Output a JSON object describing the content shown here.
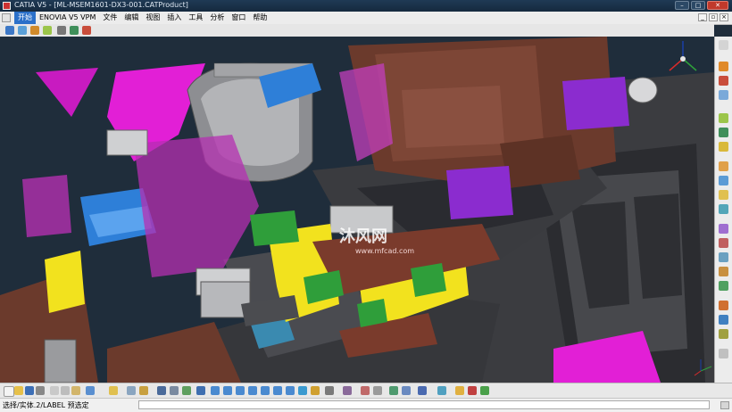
{
  "window": {
    "title": "CATIA V5 - [ML-MSEM1601-DX3-001.CATProduct]"
  },
  "menubar": {
    "items": [
      "开始",
      "ENOVIA V5 VPM",
      "文件",
      "编辑",
      "视图",
      "插入",
      "工具",
      "分析",
      "窗口",
      "帮助"
    ]
  },
  "watermark": {
    "text": "沐风网",
    "sub": "www.mfcad.com"
  },
  "status": {
    "text": "选择/实体.2/LABEL 预选定"
  },
  "branding": {
    "logo_text": "CATIA"
  },
  "colors": {
    "viewport_bg": "#1f2d3b",
    "menu_active": "#2b70c9",
    "part_magenta": "#e21fd6",
    "part_brown": "#6b3a2c",
    "part_yellow": "#f2e21e",
    "part_blue": "#2e7fd8",
    "part_green": "#2f9e3a",
    "part_purple": "#8b2ccf",
    "frame_gray": "#3e3f43"
  }
}
